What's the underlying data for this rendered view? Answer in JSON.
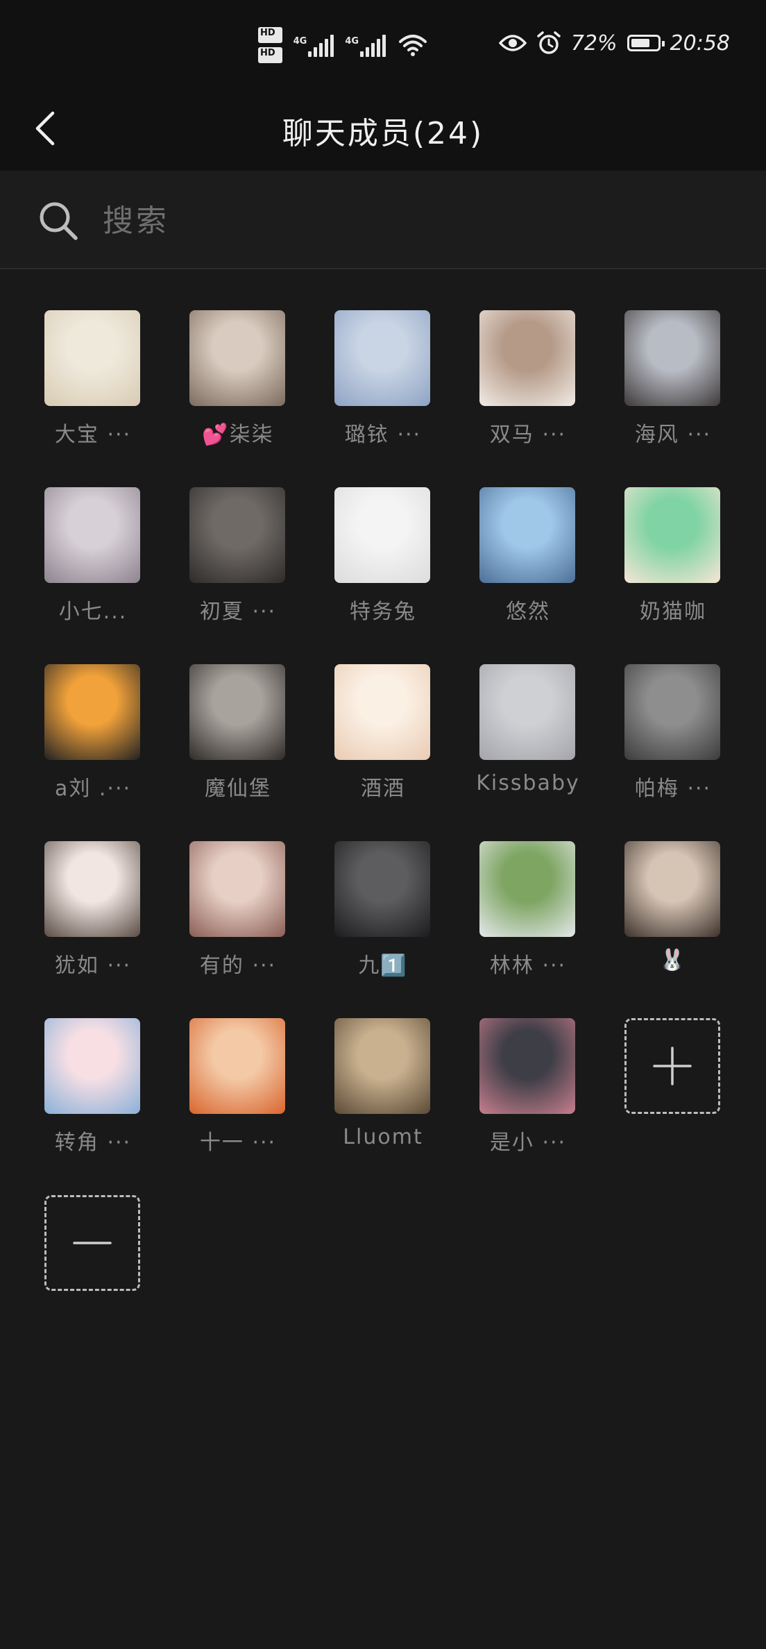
{
  "status_bar": {
    "hd1": "HD",
    "hd1_sub": "1",
    "hd2": "HD",
    "hd2_sub": "2",
    "net1": "4G",
    "net2": "4G",
    "battery_percent": "72%",
    "battery_level": 0.72,
    "time": "20:58"
  },
  "nav": {
    "title": "聊天成员(24)"
  },
  "search": {
    "placeholder": "搜索",
    "value": ""
  },
  "members": [
    {
      "name": "大宝 ···",
      "avatar_colors": [
        "#efe9dc",
        "#d8cbb2"
      ]
    },
    {
      "name": "💕柒柒",
      "avatar_colors": [
        "#d9cbbf",
        "#7c6a5e"
      ]
    },
    {
      "name": "璐铱 ···",
      "avatar_colors": [
        "#c9d4e4",
        "#8ea3c4"
      ]
    },
    {
      "name": "双马 ···",
      "avatar_colors": [
        "#b59a88",
        "#f1ece6"
      ]
    },
    {
      "name": "海风 ···",
      "avatar_colors": [
        "#b8bcc4",
        "#3f3a3a"
      ]
    },
    {
      "name": "小七...",
      "avatar_colors": [
        "#d7d0d6",
        "#8e8390"
      ]
    },
    {
      "name": "初夏 ···",
      "avatar_colors": [
        "#6f6a66",
        "#2e2b2a"
      ]
    },
    {
      "name": "特务兔",
      "avatar_colors": [
        "#f4f4f4",
        "#dcdcdc"
      ]
    },
    {
      "name": "悠然",
      "avatar_colors": [
        "#9fc7e8",
        "#4d6f98"
      ]
    },
    {
      "name": "奶猫咖",
      "avatar_colors": [
        "#7fd3a4",
        "#f6e6d6"
      ]
    },
    {
      "name": "a刘 .···",
      "avatar_colors": [
        "#f2a23a",
        "#222222"
      ]
    },
    {
      "name": "魔仙堡",
      "avatar_colors": [
        "#a9a39d",
        "#2f2b28"
      ]
    },
    {
      "name": "酒酒",
      "avatar_colors": [
        "#fbf0e4",
        "#e9cbb3"
      ]
    },
    {
      "name": "Kissbaby",
      "avatar_colors": [
        "#cfd0d4",
        "#a4a5aa"
      ]
    },
    {
      "name": "帕梅 ···",
      "avatar_colors": [
        "#8e8e8e",
        "#3c3c3c"
      ]
    },
    {
      "name": "犹如 ···",
      "avatar_colors": [
        "#f1e6e2",
        "#5a4d46"
      ]
    },
    {
      "name": "有的 ···",
      "avatar_colors": [
        "#e7cfc6",
        "#8a5e55"
      ]
    },
    {
      "name": "九1️⃣",
      "avatar_colors": [
        "#5d5d60",
        "#1c1c1e"
      ]
    },
    {
      "name": "林林 ···",
      "avatar_colors": [
        "#7ea562",
        "#e5e8ec"
      ]
    },
    {
      "name": "🐰",
      "avatar_colors": [
        "#d6c4b4",
        "#3d322c"
      ]
    },
    {
      "name": "转角 ···",
      "avatar_colors": [
        "#f7dfe4",
        "#8ab0d8"
      ]
    },
    {
      "name": "十一 ···",
      "avatar_colors": [
        "#f3c9a6",
        "#d9652e"
      ]
    },
    {
      "name": "Lluomt",
      "avatar_colors": [
        "#c9b18f",
        "#5b4a36"
      ]
    },
    {
      "name": "是小 ···",
      "avatar_colors": [
        "#3e3e46",
        "#c77e8e"
      ]
    }
  ],
  "actions": {
    "add_symbol": "+",
    "remove_symbol": "—"
  }
}
